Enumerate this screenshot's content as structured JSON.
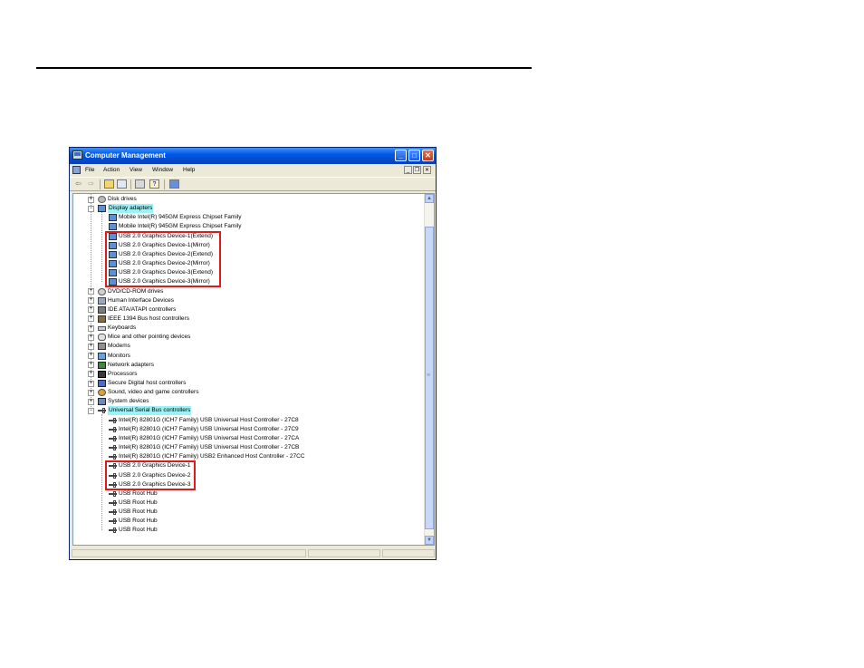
{
  "window": {
    "title": "Computer Management"
  },
  "menu": [
    "File",
    "Action",
    "View",
    "Window",
    "Help"
  ],
  "toolbar_icons": [
    "back-arrow-icon",
    "forward-arrow-icon",
    "up-folder-icon",
    "show-hide-tree-icon",
    "print-icon",
    "help-icon",
    "properties-icon"
  ],
  "tree": [
    {
      "label": "Disk drives",
      "level": 0,
      "expander": "+",
      "icon": "disk-drive-icon"
    },
    {
      "label": "Display adapters",
      "level": 0,
      "expander": "-",
      "icon": "display-adapter-icon",
      "selected": true
    },
    {
      "label": "Mobile Intel(R) 945GM Express Chipset Family",
      "level": 1,
      "icon": "display-adapter-icon"
    },
    {
      "label": "Mobile Intel(R) 945GM Express Chipset Family",
      "level": 1,
      "icon": "display-adapter-icon"
    },
    {
      "label": "USB 2.0 Graphics Device-1(Extend)",
      "level": 1,
      "icon": "display-adapter-icon"
    },
    {
      "label": "USB 2.0 Graphics Device-1(Mirror)",
      "level": 1,
      "icon": "display-adapter-icon"
    },
    {
      "label": "USB 2.0 Graphics Device-2(Extend)",
      "level": 1,
      "icon": "display-adapter-icon"
    },
    {
      "label": "USB 2.0 Graphics Device-2(Mirror)",
      "level": 1,
      "icon": "display-adapter-icon"
    },
    {
      "label": "USB 2.0 Graphics Device-3(Extend)",
      "level": 1,
      "icon": "display-adapter-icon"
    },
    {
      "label": "USB 2.0 Graphics Device-3(Mirror)",
      "level": 1,
      "icon": "display-adapter-icon"
    },
    {
      "label": "DVD/CD-ROM drives",
      "level": 0,
      "expander": "+",
      "icon": "dvd-drive-icon"
    },
    {
      "label": "Human Interface Devices",
      "level": 0,
      "expander": "+",
      "icon": "hid-icon"
    },
    {
      "label": "IDE ATA/ATAPI controllers",
      "level": 0,
      "expander": "+",
      "icon": "ide-controller-icon"
    },
    {
      "label": "IEEE 1394 Bus host controllers",
      "level": 0,
      "expander": "+",
      "icon": "ieee1394-icon"
    },
    {
      "label": "Keyboards",
      "level": 0,
      "expander": "+",
      "icon": "keyboard-icon"
    },
    {
      "label": "Mice and other pointing devices",
      "level": 0,
      "expander": "+",
      "icon": "mouse-icon"
    },
    {
      "label": "Modems",
      "level": 0,
      "expander": "+",
      "icon": "modem-icon"
    },
    {
      "label": "Monitors",
      "level": 0,
      "expander": "+",
      "icon": "monitor-icon"
    },
    {
      "label": "Network adapters",
      "level": 0,
      "expander": "+",
      "icon": "network-adapter-icon"
    },
    {
      "label": "Processors",
      "level": 0,
      "expander": "+",
      "icon": "processor-icon"
    },
    {
      "label": "Secure Digital host controllers",
      "level": 0,
      "expander": "+",
      "icon": "sd-controller-icon"
    },
    {
      "label": "Sound, video and game controllers",
      "level": 0,
      "expander": "+",
      "icon": "sound-icon"
    },
    {
      "label": "System devices",
      "level": 0,
      "expander": "+",
      "icon": "system-device-icon"
    },
    {
      "label": "Universal Serial Bus controllers",
      "level": 0,
      "expander": "-",
      "icon": "usb-icon",
      "selected": true
    },
    {
      "label": "Intel(R) 82801G (ICH7 Family) USB Universal Host Controller - 27C8",
      "level": 1,
      "icon": "usb-icon"
    },
    {
      "label": "Intel(R) 82801G (ICH7 Family) USB Universal Host Controller - 27C9",
      "level": 1,
      "icon": "usb-icon"
    },
    {
      "label": "Intel(R) 82801G (ICH7 Family) USB Universal Host Controller - 27CA",
      "level": 1,
      "icon": "usb-icon"
    },
    {
      "label": "Intel(R) 82801G (ICH7 Family) USB Universal Host Controller - 27CB",
      "level": 1,
      "icon": "usb-icon"
    },
    {
      "label": "Intel(R) 82801G (ICH7 Family) USB2 Enhanced Host Controller - 27CC",
      "level": 1,
      "icon": "usb-icon"
    },
    {
      "label": "USB 2.0 Graphics Device-1",
      "level": 1,
      "icon": "usb-icon"
    },
    {
      "label": "USB 2.0 Graphics Device-2",
      "level": 1,
      "icon": "usb-icon"
    },
    {
      "label": "USB 2.0 Graphics Device-3",
      "level": 1,
      "icon": "usb-icon"
    },
    {
      "label": "USB Root Hub",
      "level": 1,
      "icon": "usb-icon"
    },
    {
      "label": "USB Root Hub",
      "level": 1,
      "icon": "usb-icon"
    },
    {
      "label": "USB Root Hub",
      "level": 1,
      "icon": "usb-icon"
    },
    {
      "label": "USB Root Hub",
      "level": 1,
      "icon": "usb-icon"
    },
    {
      "label": "USB Root Hub",
      "level": 1,
      "icon": "usb-icon"
    }
  ],
  "highlight_color": "#e01919",
  "selection_color": "#9cf3f7"
}
